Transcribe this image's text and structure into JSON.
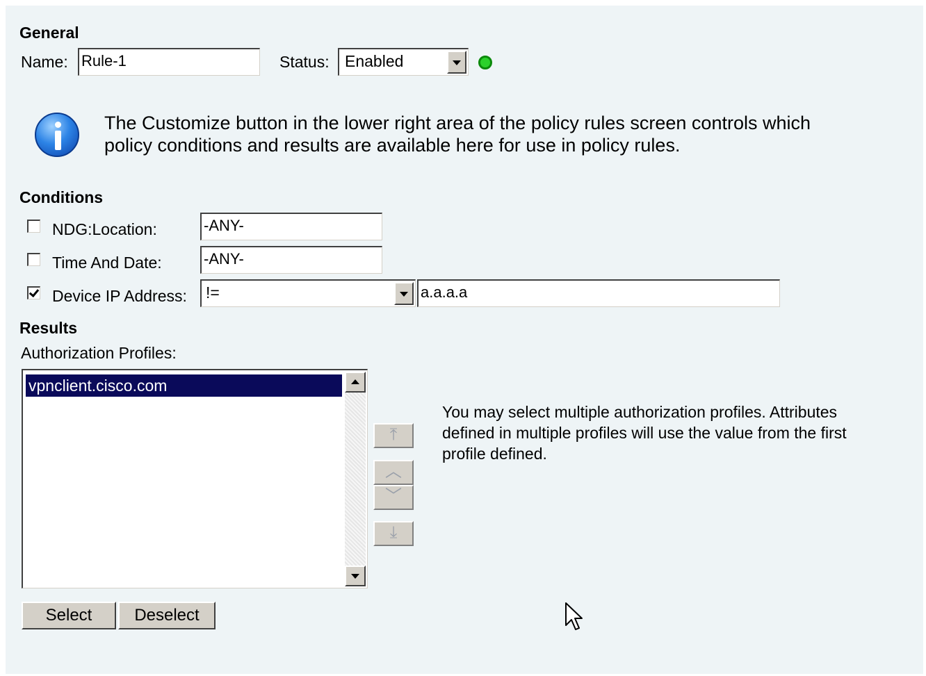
{
  "general": {
    "heading": "General",
    "name_label": "Name:",
    "name_value": "Rule-1",
    "status_label": "Status:",
    "status_value": "Enabled",
    "status_color": "#2bd12b"
  },
  "info": {
    "icon": "info-icon",
    "text_line1": "The Customize button in the lower right area of the policy rules screen controls which",
    "text_line2": "policy conditions and results are available here for use in policy rules."
  },
  "conditions": {
    "heading": "Conditions",
    "items": [
      {
        "label": "NDG:Location:",
        "checked": false,
        "value": "-ANY-"
      },
      {
        "label": "Time And Date:",
        "checked": false,
        "value": "-ANY-"
      },
      {
        "label": "Device IP Address:",
        "checked": true,
        "operator": "!=",
        "value": "a.a.a.a"
      }
    ]
  },
  "results": {
    "heading": "Results",
    "profiles_label": "Authorization Profiles:",
    "profiles": [
      "vpnclient.cisco.com"
    ],
    "selected_color": "#0a0a5a",
    "move_buttons": [
      "move-top",
      "move-up",
      "move-down",
      "move-bottom"
    ],
    "note_line1": "You may select multiple authorization profiles. Attributes",
    "note_line2": "defined in multiple profiles will use the value from the first",
    "note_line3": "profile defined.",
    "select_label": "Select",
    "deselect_label": "Deselect"
  }
}
